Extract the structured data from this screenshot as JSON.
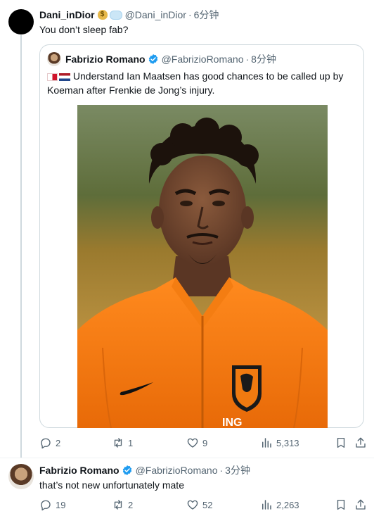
{
  "reply_top": {
    "name": "Dani_inDior",
    "handle": "@Dani_inDior",
    "time": "6分钟",
    "text": "You don’t sleep fab?"
  },
  "quoted": {
    "name": "Fabrizio Romano",
    "handle": "@FabrizioRomano",
    "time": "8分钟",
    "text": "Understand Ian Maatsen has good chances to be called up by Koeman after Frenkie de Jong’s injury.",
    "photo_alt": "Ian Maatsen in Netherlands orange jersey",
    "jersey_sponsor": "ING"
  },
  "reply_top_actions": {
    "replies": "2",
    "retweets": "1",
    "likes": "9",
    "views": "5,313"
  },
  "reply_bottom": {
    "name": "Fabrizio Romano",
    "handle": "@FabrizioRomano",
    "time": "3分钟",
    "text": "that’s not new unfortunately mate"
  },
  "reply_bottom_actions": {
    "replies": "19",
    "retweets": "2",
    "likes": "52",
    "views": "2,263"
  },
  "colors": {
    "muted": "#536471",
    "border": "#cfd9de",
    "verified": "#1d9bf0",
    "orange": "#f07a10"
  }
}
